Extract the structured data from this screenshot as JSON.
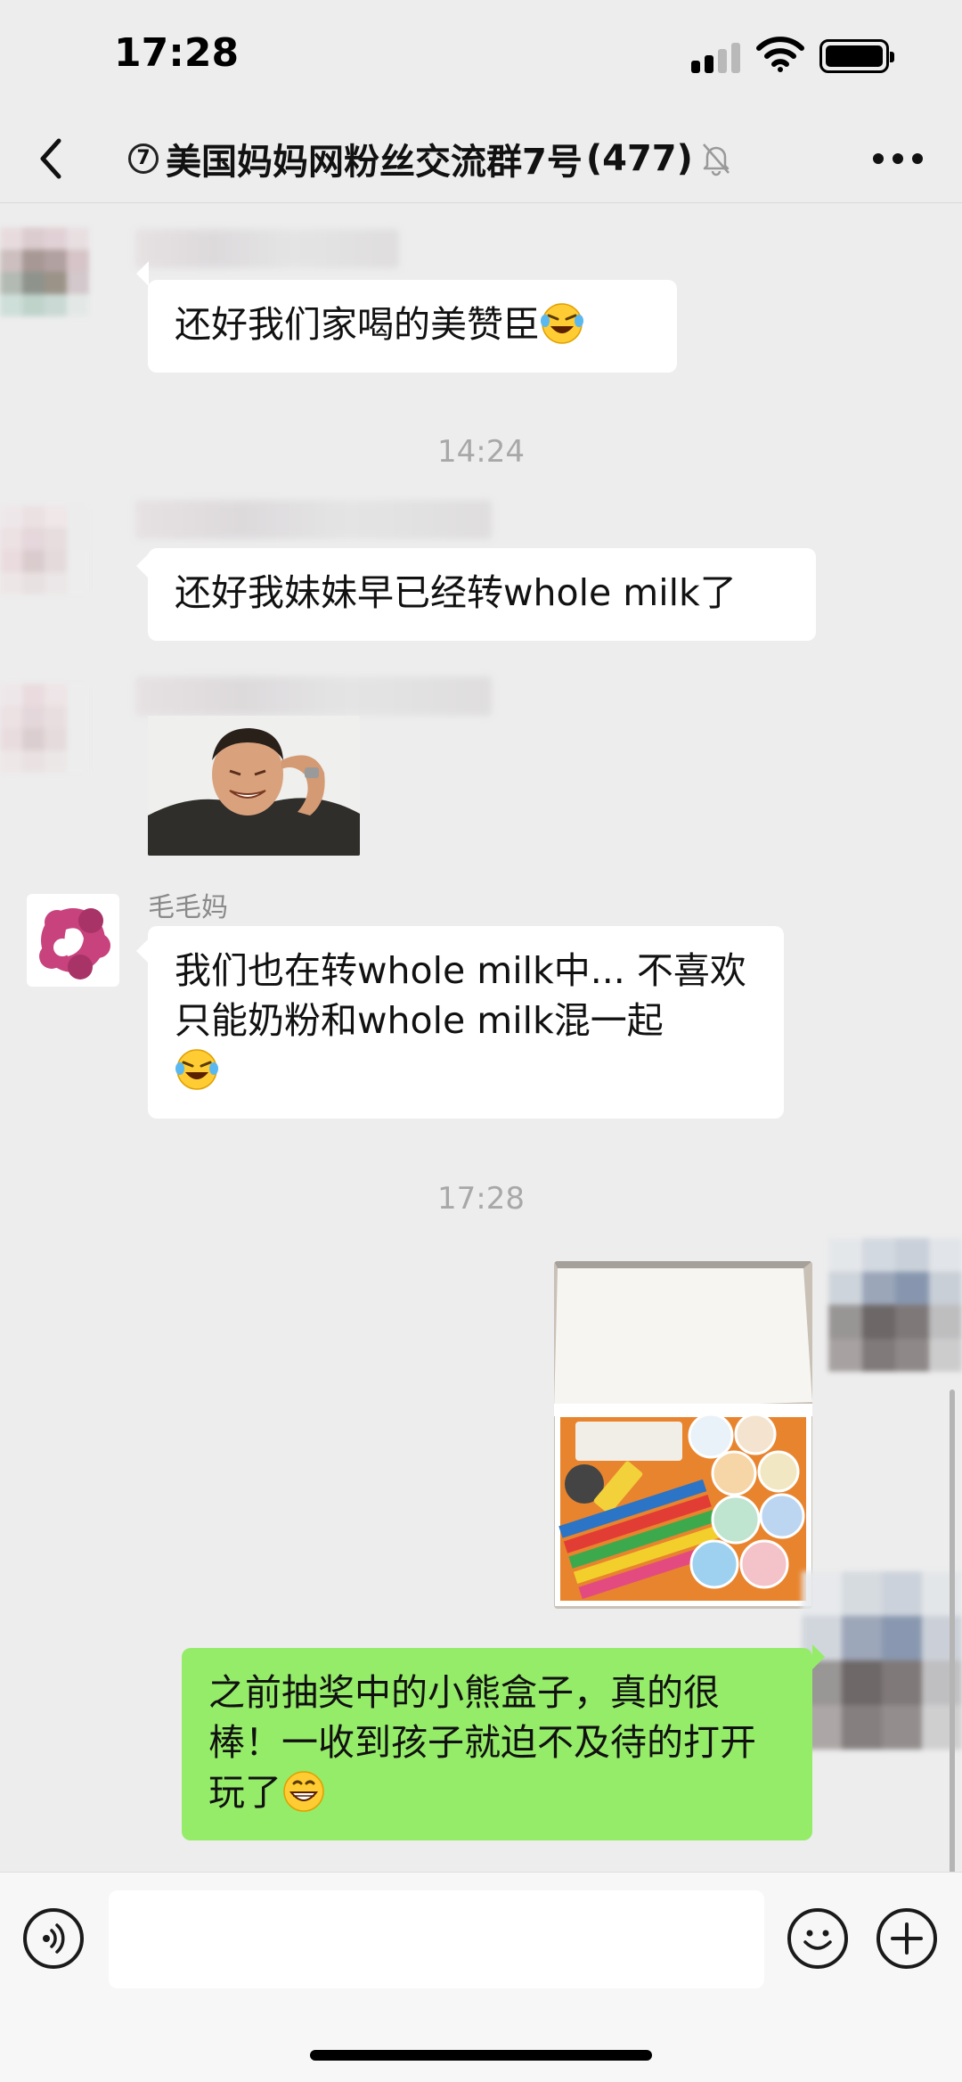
{
  "status_bar": {
    "time": "17:28"
  },
  "nav": {
    "group_index": "7",
    "title": "美国妈妈网粉丝交流群7号",
    "member_count": "(477)"
  },
  "messages": [
    {
      "type": "text",
      "side": "left",
      "sender": "",
      "text": "还好我们家喝的美赞臣",
      "emoji": "laughing-tears-tilted"
    },
    {
      "type": "time",
      "text": "14:24"
    },
    {
      "type": "text",
      "side": "left",
      "sender": "",
      "text": "还好我妹妹早已经转whole milk了"
    },
    {
      "type": "image",
      "side": "left",
      "sender": "",
      "content": "crying-man-sticker"
    },
    {
      "type": "text",
      "side": "left",
      "sender": "毛毛妈",
      "text": "我们也在转whole milk中... 不喜欢 只能奶粉和whole milk混一起",
      "emoji": "laughing-tears"
    },
    {
      "type": "time",
      "text": "17:28"
    },
    {
      "type": "image",
      "side": "right",
      "content": "toy-box-photo"
    },
    {
      "type": "text",
      "side": "right",
      "text": "之前抽奖中的小熊盒子，真的很棒！一收到孩子就迫不及待的打开玩了",
      "emoji": "grinning-face"
    }
  ],
  "input": {
    "value": "",
    "placeholder": ""
  },
  "icons": {
    "back": "chevron-left-icon",
    "more": "more-dots-icon",
    "mute": "bell-muted-icon",
    "voice": "voice-icon",
    "emoji": "smiley-icon",
    "plus": "plus-icon"
  },
  "colors": {
    "background": "#ededed",
    "bubble_other": "#ffffff",
    "bubble_self": "#95ec69",
    "timestamp": "#a8a8a8"
  }
}
